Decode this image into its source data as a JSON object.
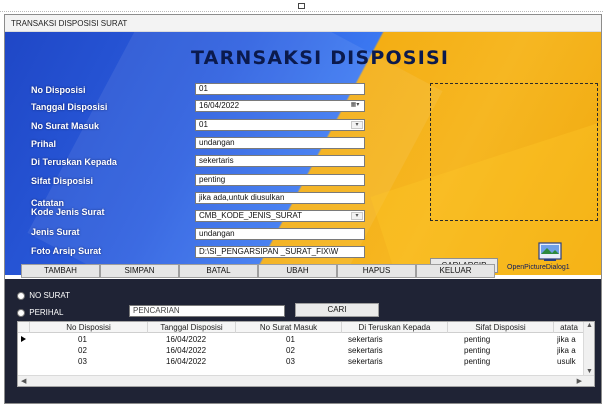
{
  "window": {
    "title": "TRANSAKSI DISPOSISI SURAT"
  },
  "page": {
    "heading": "TARNSAKSI DISPOSISI"
  },
  "form": {
    "no_disposisi": {
      "label": "No Disposisi",
      "value": "01"
    },
    "tanggal_disposisi": {
      "label": "Tanggal Disposisi",
      "value": "16/04/2022"
    },
    "no_surat_masuk": {
      "label": "No Surat Masuk",
      "value": "01"
    },
    "perihal": {
      "label": "Prihal",
      "value": "undangan"
    },
    "diteruskan_kepada": {
      "label": "Di Teruskan Kepada",
      "value": "sekertaris"
    },
    "sifat_disposisi": {
      "label": "Sifat Disposisi",
      "value": "penting"
    },
    "catatan": {
      "label": "Catatan",
      "value": "jika ada,untuk diusulkan"
    },
    "kode_jenis_surat": {
      "label": "Kode Jenis Surat",
      "value": "CMB_KODE_JENIS_SURAT"
    },
    "jenis_surat": {
      "label": "Jenis Surat",
      "value": "undangan"
    },
    "foto_arsip_surat": {
      "label": "Foto Arsip Surat",
      "value": "D:\\SI_PENGARSIPAN _SURAT_FIX\\W"
    }
  },
  "buttons": {
    "cari_arsip": "CARI ARSIP",
    "open_picture_dialog": "OpenPictureDialog1",
    "tambah": "TAMBAH",
    "simpan": "SIMPAN",
    "batal": "BATAL",
    "ubah": "UBAH",
    "hapus": "HAPUS",
    "keluar": "KELUAR",
    "cari": "CARI"
  },
  "search": {
    "option_no_surat": "NO SURAT",
    "option_perihal": "PERIHAL",
    "input_value": "PENCARIAN"
  },
  "grid": {
    "columns": [
      "No Disposisi",
      "Tanggal Disposisi",
      "No Surat Masuk",
      "Di Teruskan Kepada",
      "Sifat Disposisi",
      "atata"
    ],
    "rows": [
      [
        "01",
        "16/04/2022",
        "01",
        "sekertaris",
        "penting",
        "jika a"
      ],
      [
        "02",
        "16/04/2022",
        "02",
        "sekertaris",
        "penting",
        "jika a"
      ],
      [
        "03",
        "16/04/2022",
        "03",
        "sekertaris",
        "penting",
        "usulk"
      ]
    ]
  },
  "colors": {
    "blue_bg": "#2c5fe0",
    "orange_bg": "#f4ae14",
    "heading": "#0b1a4d"
  },
  "icons": {
    "dropdown": "chevron-down-icon",
    "calendar": "calendar-icon",
    "picture": "picture-icon",
    "row_pointer": "row-pointer-icon"
  }
}
